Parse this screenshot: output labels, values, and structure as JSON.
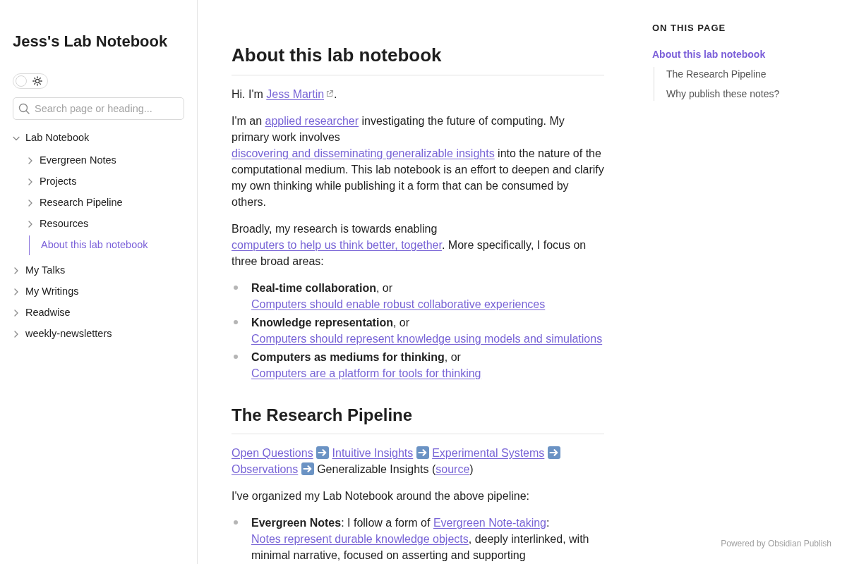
{
  "site": {
    "title": "Jess's Lab Notebook"
  },
  "theme_toggle": {
    "on": false
  },
  "search": {
    "placeholder": "Search page or heading..."
  },
  "nav": [
    {
      "label": "Lab Notebook",
      "kind": "folder",
      "expanded": true,
      "selected": false,
      "children": [
        {
          "label": "Evergreen Notes",
          "kind": "folder",
          "expanded": false,
          "selected": false
        },
        {
          "label": "Projects",
          "kind": "folder",
          "expanded": false,
          "selected": false
        },
        {
          "label": "Research Pipeline",
          "kind": "folder",
          "expanded": false,
          "selected": false
        },
        {
          "label": "Resources",
          "kind": "folder",
          "expanded": false,
          "selected": false
        },
        {
          "label": "About this lab notebook",
          "kind": "note",
          "selected": true
        }
      ]
    },
    {
      "label": "My Talks",
      "kind": "folder",
      "expanded": false,
      "selected": false
    },
    {
      "label": "My Writings",
      "kind": "folder",
      "expanded": false,
      "selected": false
    },
    {
      "label": "Readwise",
      "kind": "folder",
      "expanded": false,
      "selected": false
    },
    {
      "label": "weekly-newsletters",
      "kind": "folder",
      "expanded": false,
      "selected": false
    }
  ],
  "article": {
    "blocks": [
      {
        "kind": "title",
        "text": "About this lab notebook"
      },
      {
        "kind": "paragraph",
        "segments": [
          {
            "kind": "text",
            "text": "Hi. I'm "
          },
          {
            "kind": "external_link",
            "text": "Jess Martin"
          },
          {
            "kind": "text",
            "text": "."
          }
        ]
      },
      {
        "kind": "paragraph",
        "segments": [
          {
            "kind": "text",
            "text": "I'm an "
          },
          {
            "kind": "link",
            "text": "applied researcher"
          },
          {
            "kind": "text",
            "text": " investigating the future of computing. My primary work involves "
          },
          {
            "kind": "link",
            "text": "discovering and disseminating generalizable insights"
          },
          {
            "kind": "text",
            "text": " into the nature of the computational medium. This lab notebook is an effort to deepen and clarify my own thinking while publishing it a form that can be consumed by others."
          }
        ]
      },
      {
        "kind": "paragraph",
        "segments": [
          {
            "kind": "text",
            "text": "Broadly, my research is towards enabling "
          },
          {
            "kind": "link",
            "text": "computers to help us think better, together"
          },
          {
            "kind": "text",
            "text": ". More specifically, I focus on three broad areas:"
          }
        ]
      },
      {
        "kind": "list",
        "items": [
          {
            "segments": [
              {
                "kind": "text",
                "text": "**Real-time collaboration**, or "
              },
              {
                "kind": "link",
                "text": "Computers should enable robust collaborative experiences"
              }
            ]
          },
          {
            "segments": [
              {
                "kind": "text",
                "text": "**Knowledge representation**, or "
              },
              {
                "kind": "link",
                "text": "Computers should represent knowledge using models and simulations"
              }
            ]
          },
          {
            "segments": [
              {
                "kind": "text",
                "text": "**Computers as mediums for thinking**, or "
              },
              {
                "kind": "link",
                "text": "Computers are a platform for tools for thinking"
              }
            ]
          }
        ]
      },
      {
        "kind": "heading",
        "text": "The Research Pipeline"
      },
      {
        "kind": "pipeline",
        "steps": [
          [
            {
              "kind": "link",
              "text": "Open Questions"
            }
          ],
          [
            {
              "kind": "link",
              "text": "Intuitive Insights"
            }
          ],
          [
            {
              "kind": "link",
              "text": "Experimental Systems"
            }
          ],
          [
            {
              "kind": "link",
              "text": "Observations"
            }
          ],
          [
            {
              "kind": "text",
              "text": "Generalizable Insights ("
            },
            {
              "kind": "link",
              "text": "source"
            },
            {
              "kind": "text",
              "text": ")"
            }
          ]
        ]
      },
      {
        "kind": "paragraph",
        "segments": [
          {
            "kind": "text",
            "text": "I've organized my Lab Notebook around the above pipeline:"
          }
        ]
      },
      {
        "kind": "list",
        "items": [
          {
            "segments": [
              {
                "kind": "text",
                "text": "**Evergreen Notes**: I follow a form of "
              },
              {
                "kind": "link",
                "text": "Evergreen Note-taking"
              },
              {
                "kind": "text",
                "text": ": "
              },
              {
                "kind": "link",
                "text": "Notes represent durable knowledge objects"
              },
              {
                "kind": "text",
                "text": ", deeply interlinked, with minimal narrative, focused on asserting and supporting"
              }
            ]
          }
        ]
      }
    ]
  },
  "toc": {
    "title": "ON THIS PAGE",
    "items": [
      {
        "label": "About this lab notebook",
        "selected": true,
        "children": [
          {
            "label": "The Research Pipeline",
            "selected": false
          },
          {
            "label": "Why publish these notes?",
            "selected": false
          }
        ]
      }
    ]
  },
  "footer": {
    "text": "Powered by Obsidian Publish"
  }
}
